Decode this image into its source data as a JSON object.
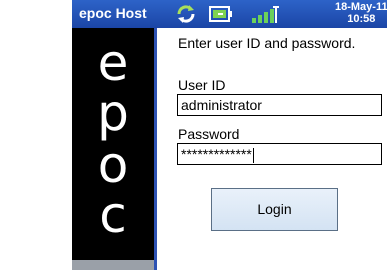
{
  "titlebar": {
    "app_title": "epoc Host",
    "date": "18-May-11",
    "time": "10:58",
    "icons": [
      "sync-icon",
      "battery-icon",
      "signal-icon"
    ]
  },
  "sidebar": {
    "logo_letters": [
      "e",
      "p",
      "o",
      "c"
    ]
  },
  "login": {
    "instructions": "Enter user ID and password.",
    "user_id_label": "User ID",
    "user_id_value": "administrator",
    "password_label": "Password",
    "password_value": "*************",
    "login_button": "Login"
  },
  "colors": {
    "titlebar": "#1b45a6",
    "sidebar": "#000000",
    "button": "#d4e3f3"
  }
}
